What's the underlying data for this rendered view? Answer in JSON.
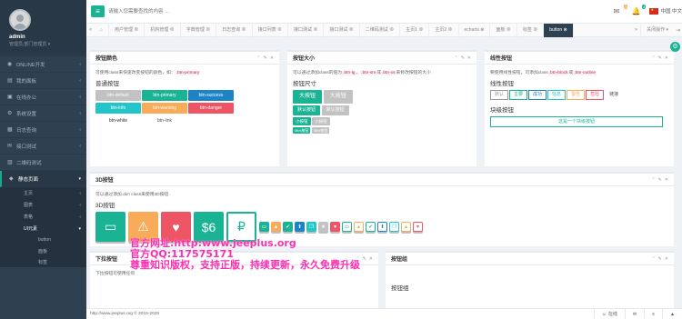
{
  "user": {
    "name": "admin",
    "role": "管理员,部门管理员 ▾"
  },
  "nav": [
    {
      "icon": "◉",
      "label": "ONLINE开发",
      "arrow": "‹"
    },
    {
      "icon": "▤",
      "label": "我的面板",
      "arrow": "‹"
    },
    {
      "icon": "▣",
      "label": "在线办公",
      "arrow": "‹"
    },
    {
      "icon": "⚙",
      "label": "系统设置",
      "arrow": "‹"
    },
    {
      "icon": "▦",
      "label": "日志查询",
      "arrow": "‹"
    },
    {
      "icon": "✉",
      "label": "接口测试",
      "arrow": "‹"
    },
    {
      "icon": "▥",
      "label": "二维码测试",
      "arrow": ""
    },
    {
      "icon": "◆",
      "label": "静态页面",
      "arrow": "▾"
    }
  ],
  "subnav": [
    {
      "label": "主页",
      "arrow": "‹"
    },
    {
      "label": "图表",
      "arrow": "‹"
    },
    {
      "label": "表格",
      "arrow": "‹"
    },
    {
      "label": "UI元素",
      "arrow": "▾"
    }
  ],
  "subnav2": [
    "button",
    "面板",
    "标签"
  ],
  "search": {
    "placeholder": "请输入您需要查找的内容 …"
  },
  "badges": {
    "mail": "8",
    "bell": "4"
  },
  "lang": "中国 中文",
  "tabs": [
    "用户管理 ⊗",
    "机构管理 ⊗",
    "字典管理 ⊗",
    "日志查询 ⊗",
    "接口列表 ⊗",
    "接口测试 ⊗",
    "接口测试 ⊗",
    "二维码测试 ⊗",
    "主页1 ⊗",
    "主页2 ⊗",
    "echarts ⊗",
    "面板 ⊗",
    "标签 ⊗",
    "button ⊗"
  ],
  "close_ops": "关闭操作 ▾",
  "card_color": {
    "title": "按钮颜色",
    "desc_pre": "可使用class来快速改变按钮的颜色，如：",
    "desc_code": ".btn-primary",
    "sub": "普通按钮",
    "buttons": [
      {
        "label": "btn-default",
        "cls": "bg-default"
      },
      {
        "label": "btn-primary",
        "cls": "bg-primary"
      },
      {
        "label": "btn-success",
        "cls": "bg-success"
      },
      {
        "label": "btn-info",
        "cls": "bg-info"
      },
      {
        "label": "btn-warning",
        "cls": "bg-warning"
      },
      {
        "label": "btn-danger",
        "cls": "bg-danger"
      },
      {
        "label": "btn-white",
        "cls": "bg-white"
      },
      {
        "label": "btn-link",
        "cls": "bg-link"
      }
    ]
  },
  "card_size": {
    "title": "按钮大小",
    "desc_pre": "可以通过添加class的值为",
    "c1": ".btn-lg",
    "c2": ".btn-sm",
    "c3": ".btn-xs",
    "desc_mid": "，",
    "desc_or": "或",
    "desc_post": "来修改按钮的大小",
    "sub": "按钮尺寸",
    "lg": [
      "大按钮",
      "大按钮"
    ],
    "md": [
      "默认按钮",
      "默认按钮"
    ],
    "sm": [
      "小按钮",
      "小按钮"
    ],
    "xs": [
      "Mini按钮",
      "Mini按钮"
    ]
  },
  "card_line": {
    "title": "线性按钮",
    "desc_pre": "要使用线性按钮，可添加class",
    "c1": ".btn-block",
    "desc_or": "或",
    "c2": ".btn-outline",
    "sub": "线性按钮",
    "buttons": [
      {
        "label": "默认",
        "color": "#999"
      },
      {
        "label": "主要",
        "color": "#1ab394"
      },
      {
        "label": "成功",
        "color": "#1c84c6"
      },
      {
        "label": "信息",
        "color": "#23c6c8"
      },
      {
        "label": "警告",
        "color": "#f8ac59"
      },
      {
        "label": "危险",
        "color": "#ed5565"
      },
      {
        "label": "链接",
        "color": "#555"
      }
    ],
    "block_sub": "块级按钮",
    "block_btn": "这是一个块级按钮"
  },
  "card_3d": {
    "title": "3D按钮",
    "desc": "可以通过添加.dim class来使用3D按钮.",
    "sub": "3D按钮",
    "large": [
      {
        "icon": "money-icon",
        "glyph": "▭",
        "color": "#1ab394"
      },
      {
        "icon": "warning-icon",
        "glyph": "⚠",
        "color": "#f8ac59"
      },
      {
        "icon": "heart-icon",
        "glyph": "♥",
        "color": "#ed5565"
      },
      {
        "icon": "dollar-text",
        "glyph": "$6",
        "color": "#1ab394"
      },
      {
        "icon": "ruble-icon",
        "glyph": "₽",
        "color": "#fff",
        "line": "#1ab394"
      }
    ],
    "small": [
      {
        "icon": "money-icon",
        "glyph": "▭",
        "color": "#1ab394"
      },
      {
        "icon": "warning-icon",
        "glyph": "▲",
        "color": "#f8ac59"
      },
      {
        "icon": "check-icon",
        "glyph": "✔",
        "color": "#1ab394"
      },
      {
        "icon": "upload-icon",
        "glyph": "⬆",
        "color": "#1c84c6"
      },
      {
        "icon": "copy-icon",
        "glyph": "❐",
        "color": "#23c6c8"
      },
      {
        "icon": "star-icon",
        "glyph": "★",
        "color": "#c2c2c2"
      },
      {
        "icon": "heart-icon",
        "glyph": "♥",
        "color": "#ed5565"
      },
      {
        "icon": "money-icon",
        "glyph": "▭",
        "color": "#1ab394",
        "line": true
      },
      {
        "icon": "warning-icon",
        "glyph": "▲",
        "color": "#f8ac59",
        "line": true
      },
      {
        "icon": "check-icon",
        "glyph": "✔",
        "color": "#1ab394",
        "line": true
      },
      {
        "icon": "upload-icon",
        "glyph": "⬆",
        "color": "#1c84c6",
        "line": true
      },
      {
        "icon": "copy-icon",
        "glyph": "❐",
        "color": "#23c6c8",
        "line": true
      },
      {
        "icon": "warning-icon",
        "glyph": "▲",
        "color": "#f8ac59",
        "line": true
      },
      {
        "icon": "heart-icon",
        "glyph": "♥",
        "color": "#ed5565",
        "line": true
      }
    ]
  },
  "card_dropdown": {
    "title": "下拉按钮",
    "desc": "下拉按钮可使用任何"
  },
  "card_group": {
    "title": "按钮组",
    "sub": "按钮组"
  },
  "footer": {
    "left": "http://www.jeeplus.org © 2015-2025",
    "online": "在线"
  },
  "watermark": [
    "官方网址:http:www.jeeplus.org",
    "官方QQ:117575171",
    "尊重知识版权，支持正版，持续更新，永久免费升级"
  ]
}
